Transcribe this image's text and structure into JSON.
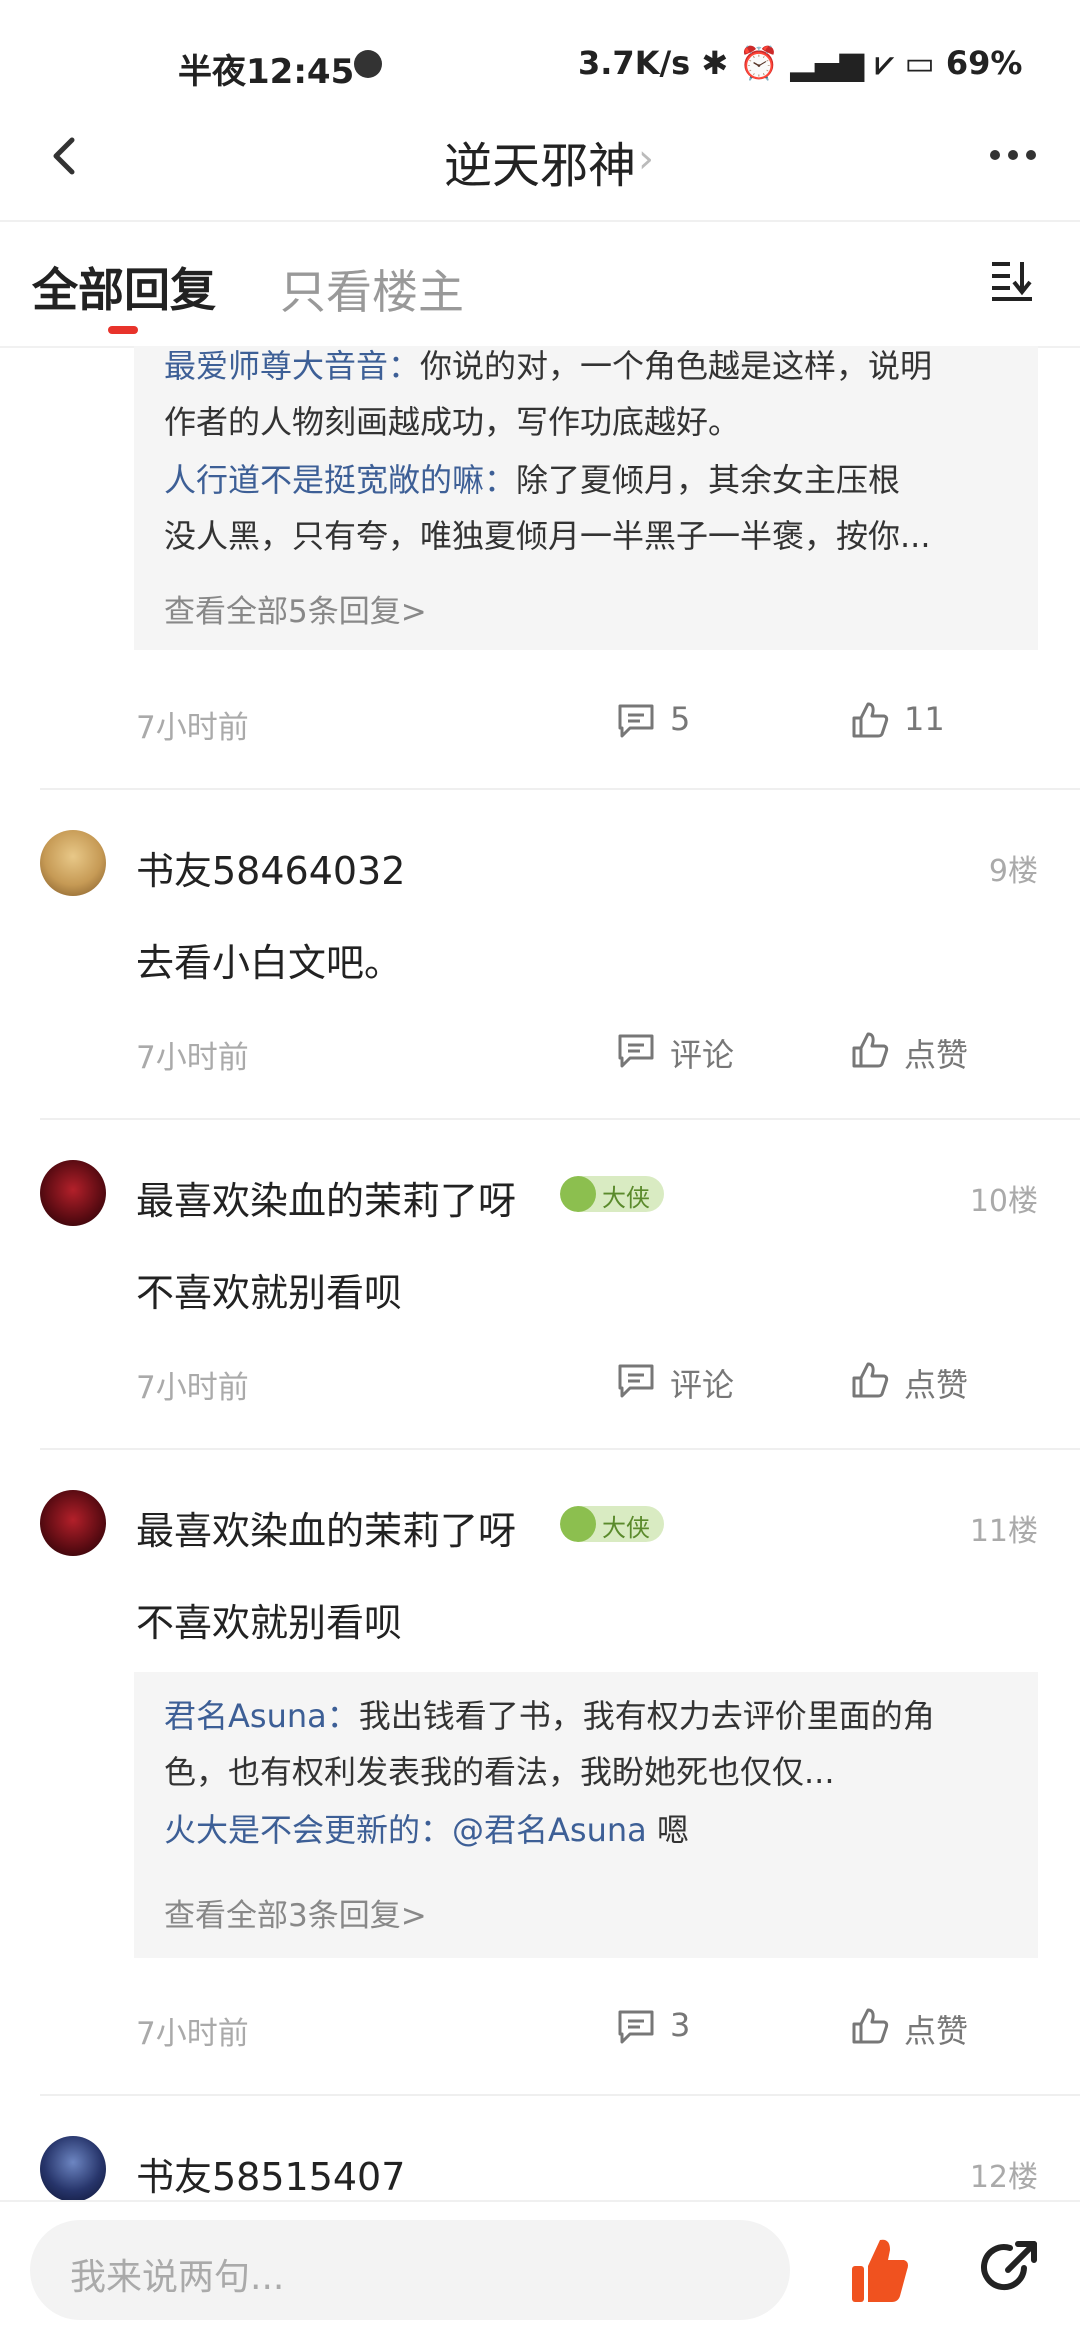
{
  "status_bar": {
    "time": "半夜12:45",
    "right": "3.7K/s ✱ ⏰ ▂▄▆ ⩗ ▭ 69%"
  },
  "nav": {
    "title": "逆天邪神",
    "chevron": "›"
  },
  "tabs": {
    "all": "全部回复",
    "owner_only": "只看楼主"
  },
  "top_thread": {
    "replies": [
      {
        "name": "最爱师尊大音音：",
        "text": "你说的对，一个角色越是这样，说明"
      },
      {
        "name": "",
        "text": "作者的人物刻画越成功，写作功底越好。"
      },
      {
        "name": "人行道不是挺宽敞的嘛：",
        "text": "除了夏倾月，其余女主压根"
      },
      {
        "name": "",
        "text": "没人黑，只有夸，唯独夏倾月一半黑子一半褒，按你..."
      }
    ],
    "view_all": "查看全部5条回复>",
    "time": "7小时前",
    "comments": "5",
    "likes": "11"
  },
  "posts": [
    {
      "user": "书友58464032",
      "floor": "9楼",
      "content": "去看小白文吧。",
      "time": "7小时前",
      "comment_label": "评论",
      "like_label": "点赞"
    },
    {
      "user": "最喜欢染血的茉莉了呀",
      "badge": "大侠",
      "floor": "10楼",
      "content": "不喜欢就别看呗",
      "time": "7小时前",
      "comment_label": "评论",
      "like_label": "点赞"
    },
    {
      "user": "最喜欢染血的茉莉了呀",
      "badge": "大侠",
      "floor": "11楼",
      "content": "不喜欢就别看呗",
      "replies": [
        {
          "name": "君名Asuna：",
          "text": "我出钱看了书，我有权力去评价里面的角"
        },
        {
          "name": "",
          "text": "色，也有权利发表我的看法，我盼她死也仅仅..."
        },
        {
          "name": "火大是不会更新的：",
          "mention": "@君名Asuna",
          "text": " 嗯"
        }
      ],
      "view_all": "查看全部3条回复>",
      "time": "7小时前",
      "comment_label": "3",
      "like_label": "点赞"
    },
    {
      "user": "书友58515407",
      "floor": "12楼"
    }
  ],
  "bottom_bar": {
    "placeholder": "我来说两句..."
  },
  "colors": {
    "accent_red": "#e8332b",
    "reply_name_blue": "#3d5f96",
    "like_orange": "#f0521f"
  }
}
